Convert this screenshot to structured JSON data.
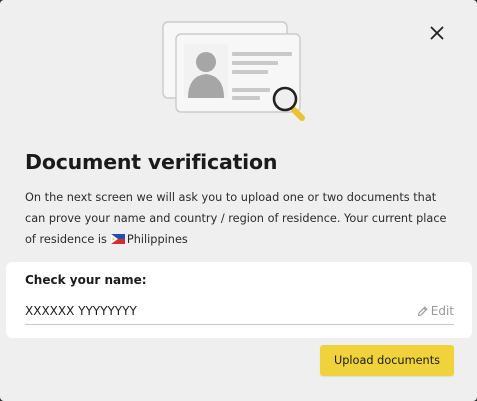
{
  "modal": {
    "title": "Document verification",
    "description": "On the next screen we will ask you to upload one or two documents that can prove your name and country / region of residence. Your current place of residence is",
    "residence": {
      "country": "Philippines",
      "flag_icon": "philippines-flag-icon"
    },
    "close_icon": "close-icon",
    "illustration_icon": "id-card-magnifier-icon"
  },
  "name_check": {
    "label": "Check your name:",
    "value": "XXXXXX YYYYYYYY",
    "edit_label": "Edit",
    "edit_icon": "pencil-icon"
  },
  "actions": {
    "upload_label": "Upload documents"
  },
  "colors": {
    "accent": "#f0d33c",
    "background": "#efefef",
    "card": "#ffffff",
    "muted": "#9a9a9a"
  }
}
